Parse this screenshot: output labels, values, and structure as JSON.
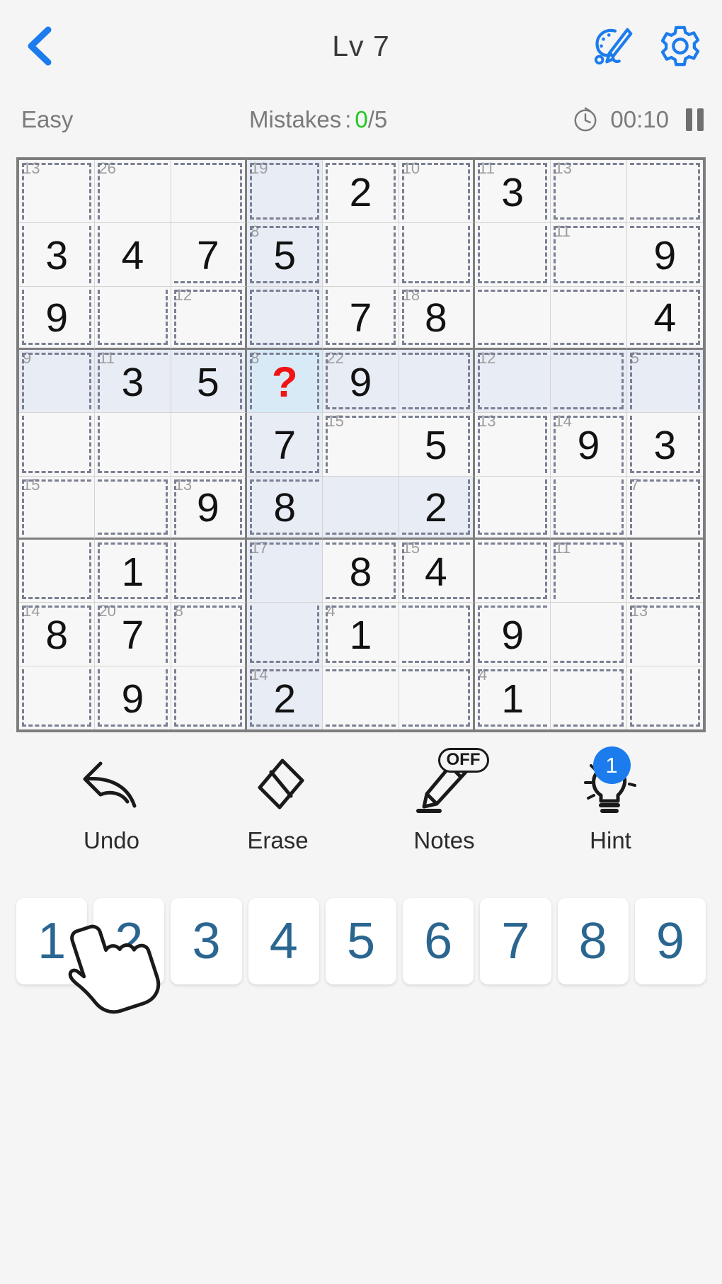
{
  "header": {
    "title": "Lv 7",
    "back_icon": "chevron-left-icon",
    "theme_icon": "palette-brush-icon",
    "settings_icon": "gear-icon"
  },
  "status": {
    "difficulty": "Easy",
    "mistakes_label": "Mistakes",
    "mistakes_colon": ":",
    "mistakes_count": "0",
    "mistakes_total": "/5",
    "clock_icon": "clock-icon",
    "timer": "00:10",
    "pause_icon": "pause-icon"
  },
  "colors": {
    "accent": "#1c7ced",
    "number_pad_text": "#2a6690",
    "selected_cell": "#d9eaf7",
    "highlight_cell": "#e8ecf5",
    "error_text": "#f01414",
    "ok_green": "#1ec81e",
    "cage_line": "#7b7f93",
    "grid_line": "#d3d3d3",
    "block_line": "#7e7e7e"
  },
  "board": {
    "rows": 9,
    "cols": 9,
    "selected": {
      "row": 3,
      "col": 3
    },
    "cells": [
      [
        {
          "v": "",
          "sum": "13",
          "cage": "A",
          "hl": false
        },
        {
          "v": "",
          "sum": "26",
          "cage": "B",
          "hl": false
        },
        {
          "v": "",
          "sum": "",
          "cage": "B",
          "hl": false
        },
        {
          "v": "",
          "sum": "19",
          "cage": "C",
          "hl": true
        },
        {
          "v": "2",
          "sum": "",
          "cage": "D",
          "hl": false
        },
        {
          "v": "",
          "sum": "10",
          "cage": "E",
          "hl": false
        },
        {
          "v": "3",
          "sum": "11",
          "cage": "F",
          "hl": false
        },
        {
          "v": "",
          "sum": "13",
          "cage": "G",
          "hl": false
        },
        {
          "v": "",
          "sum": "",
          "cage": "G",
          "hl": false
        }
      ],
      [
        {
          "v": "3",
          "sum": "",
          "cage": "A",
          "hl": false
        },
        {
          "v": "4",
          "sum": "",
          "cage": "B",
          "hl": false
        },
        {
          "v": "7",
          "sum": "",
          "cage": "B",
          "hl": false
        },
        {
          "v": "5",
          "sum": "8",
          "cage": "H",
          "hl": true
        },
        {
          "v": "",
          "sum": "",
          "cage": "D",
          "hl": false
        },
        {
          "v": "",
          "sum": "",
          "cage": "E",
          "hl": false
        },
        {
          "v": "",
          "sum": "",
          "cage": "F",
          "hl": false
        },
        {
          "v": "",
          "sum": "11",
          "cage": "I",
          "hl": false
        },
        {
          "v": "9",
          "sum": "",
          "cage": "I",
          "hl": false
        }
      ],
      [
        {
          "v": "9",
          "sum": "",
          "cage": "A",
          "hl": false
        },
        {
          "v": "",
          "sum": "",
          "cage": "B",
          "hl": false
        },
        {
          "v": "",
          "sum": "12",
          "cage": "J",
          "hl": false
        },
        {
          "v": "",
          "sum": "",
          "cage": "C",
          "hl": true
        },
        {
          "v": "7",
          "sum": "",
          "cage": "D",
          "hl": false
        },
        {
          "v": "8",
          "sum": "18",
          "cage": "K",
          "hl": false
        },
        {
          "v": "",
          "sum": "",
          "cage": "K",
          "hl": false
        },
        {
          "v": "",
          "sum": "",
          "cage": "K",
          "hl": false
        },
        {
          "v": "4",
          "sum": "",
          "cage": "K",
          "hl": false
        }
      ],
      [
        {
          "v": "",
          "sum": "9",
          "cage": "L",
          "hl": true
        },
        {
          "v": "3",
          "sum": "11",
          "cage": "M",
          "hl": true
        },
        {
          "v": "5",
          "sum": "",
          "cage": "M",
          "hl": true
        },
        {
          "v": "?",
          "sum": "8",
          "cage": "N",
          "hl": false,
          "sel": true,
          "err": true
        },
        {
          "v": "9",
          "sum": "22",
          "cage": "O",
          "hl": true
        },
        {
          "v": "",
          "sum": "",
          "cage": "O",
          "hl": true
        },
        {
          "v": "",
          "sum": "12",
          "cage": "P",
          "hl": true
        },
        {
          "v": "",
          "sum": "",
          "cage": "P",
          "hl": true
        },
        {
          "v": "",
          "sum": "5",
          "cage": "Q",
          "hl": true
        }
      ],
      [
        {
          "v": "",
          "sum": "",
          "cage": "L",
          "hl": false
        },
        {
          "v": "",
          "sum": "",
          "cage": "M",
          "hl": false
        },
        {
          "v": "",
          "sum": "",
          "cage": "M",
          "hl": false
        },
        {
          "v": "7",
          "sum": "",
          "cage": "N",
          "hl": true
        },
        {
          "v": "",
          "sum": "15",
          "cage": "R",
          "hl": false
        },
        {
          "v": "5",
          "sum": "",
          "cage": "R",
          "hl": false
        },
        {
          "v": "",
          "sum": "13",
          "cage": "S",
          "hl": false
        },
        {
          "v": "9",
          "sum": "14",
          "cage": "T",
          "hl": false
        },
        {
          "v": "3",
          "sum": "",
          "cage": "Q",
          "hl": false
        }
      ],
      [
        {
          "v": "",
          "sum": "15",
          "cage": "U",
          "hl": false
        },
        {
          "v": "",
          "sum": "",
          "cage": "U",
          "hl": false
        },
        {
          "v": "9",
          "sum": "13",
          "cage": "V",
          "hl": false
        },
        {
          "v": "8",
          "sum": "",
          "cage": "R",
          "hl": true
        },
        {
          "v": "",
          "sum": "",
          "cage": "R",
          "hl": true
        },
        {
          "v": "2",
          "sum": "",
          "cage": "R",
          "hl": true
        },
        {
          "v": "",
          "sum": "",
          "cage": "S",
          "hl": false
        },
        {
          "v": "",
          "sum": "",
          "cage": "T",
          "hl": false
        },
        {
          "v": "",
          "sum": "7",
          "cage": "W",
          "hl": false
        }
      ],
      [
        {
          "v": "",
          "sum": "",
          "cage": "U",
          "hl": false
        },
        {
          "v": "1",
          "sum": "",
          "cage": "X",
          "hl": false
        },
        {
          "v": "",
          "sum": "",
          "cage": "V",
          "hl": false
        },
        {
          "v": "",
          "sum": "17",
          "cage": "Y",
          "hl": true
        },
        {
          "v": "8",
          "sum": "",
          "cage": "Y",
          "hl": false
        },
        {
          "v": "4",
          "sum": "15",
          "cage": "Z",
          "hl": false
        },
        {
          "v": "",
          "sum": "",
          "cage": "Z",
          "hl": false
        },
        {
          "v": "",
          "sum": "11",
          "cage": "AA",
          "hl": false
        },
        {
          "v": "",
          "sum": "",
          "cage": "W",
          "hl": false
        }
      ],
      [
        {
          "v": "8",
          "sum": "14",
          "cage": "AB",
          "hl": false
        },
        {
          "v": "7",
          "sum": "20",
          "cage": "AC",
          "hl": false
        },
        {
          "v": "",
          "sum": "8",
          "cage": "AD",
          "hl": false
        },
        {
          "v": "",
          "sum": "",
          "cage": "Y",
          "hl": true
        },
        {
          "v": "1",
          "sum": "4",
          "cage": "AE",
          "hl": false
        },
        {
          "v": "",
          "sum": "",
          "cage": "AE",
          "hl": false
        },
        {
          "v": "9",
          "sum": "",
          "cage": "AA",
          "hl": false
        },
        {
          "v": "",
          "sum": "",
          "cage": "AA",
          "hl": false
        },
        {
          "v": "",
          "sum": "13",
          "cage": "AF",
          "hl": false
        }
      ],
      [
        {
          "v": "",
          "sum": "",
          "cage": "AB",
          "hl": false
        },
        {
          "v": "9",
          "sum": "",
          "cage": "AC",
          "hl": false
        },
        {
          "v": "",
          "sum": "",
          "cage": "AD",
          "hl": false
        },
        {
          "v": "2",
          "sum": "14",
          "cage": "AG",
          "hl": true
        },
        {
          "v": "",
          "sum": "",
          "cage": "AG",
          "hl": false
        },
        {
          "v": "",
          "sum": "",
          "cage": "AG",
          "hl": false
        },
        {
          "v": "1",
          "sum": "4",
          "cage": "AH",
          "hl": false
        },
        {
          "v": "",
          "sum": "",
          "cage": "AH",
          "hl": false
        },
        {
          "v": "",
          "sum": "",
          "cage": "AF",
          "hl": false
        }
      ]
    ]
  },
  "toolbar": {
    "items": [
      {
        "label": "Undo",
        "icon": "undo-arrow-icon",
        "badge": ""
      },
      {
        "label": "Erase",
        "icon": "eraser-icon",
        "badge": ""
      },
      {
        "label": "Notes",
        "icon": "pencil-notes-icon",
        "badge": "OFF"
      },
      {
        "label": "Hint",
        "icon": "lightbulb-icon",
        "badge": "1"
      }
    ]
  },
  "numpad": {
    "keys": [
      "1",
      "2",
      "3",
      "4",
      "5",
      "6",
      "7",
      "8",
      "9"
    ]
  },
  "cursor": {
    "icon": "pointing-hand-cursor"
  }
}
